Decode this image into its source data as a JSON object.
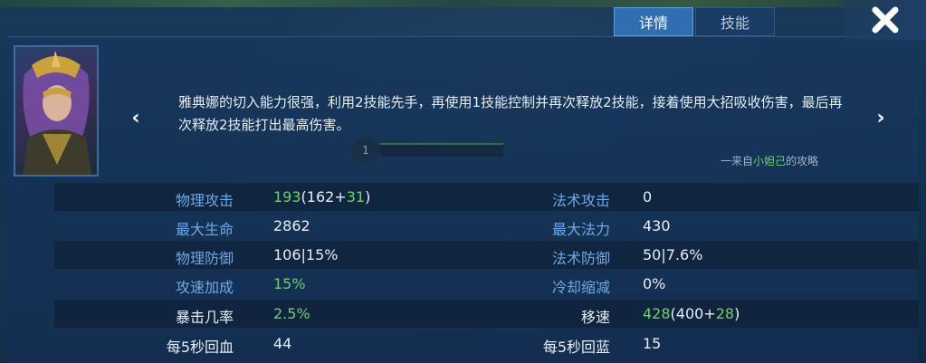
{
  "tabs": {
    "detail": "详情",
    "skills": "技能"
  },
  "description": "雅典娜的切入能力很强，利用2技能先手，再使用1技能控制并再次释放2技能，接着使用大招吸收伤害，最后再次释放2技能打出最高伤害。",
  "credit": {
    "prefix": "一来自",
    "author": "小妲己",
    "suffix": "的攻略"
  },
  "skill_slot": "1",
  "stats": {
    "phys_attack": {
      "label": "物理攻击",
      "total": "193",
      "base": "(162+",
      "bonus": "31",
      "close": ")"
    },
    "magic_attack": {
      "label": "法术攻击",
      "value": "0"
    },
    "max_hp": {
      "label": "最大生命",
      "value": "2862"
    },
    "max_mana": {
      "label": "最大法力",
      "value": "430"
    },
    "phys_def": {
      "label": "物理防御",
      "value": "106|15%"
    },
    "magic_def": {
      "label": "法术防御",
      "value": "50|7.6%"
    },
    "attack_speed": {
      "label": "攻速加成",
      "value": "15%"
    },
    "cooldown": {
      "label": "冷却缩减",
      "value": "0%"
    },
    "crit": {
      "label": "暴击几率",
      "value": "2.5%"
    },
    "move_speed": {
      "label": "移速",
      "total": "428",
      "base": "(400+",
      "bonus": "28",
      "close": ")"
    },
    "hp_regen": {
      "label": "每5秒回血",
      "value": "44"
    },
    "mana_regen": {
      "label": "每5秒回蓝",
      "value": "15"
    }
  },
  "colors": {
    "label_blue": "#6fa8e6",
    "value_white": "#e8eef5",
    "bonus_green": "#6fd06a",
    "tab_active": "#2f6fb1"
  },
  "icons": {
    "close": "close-x-icon",
    "prev": "chevron-left-icon",
    "next": "chevron-right-icon"
  }
}
